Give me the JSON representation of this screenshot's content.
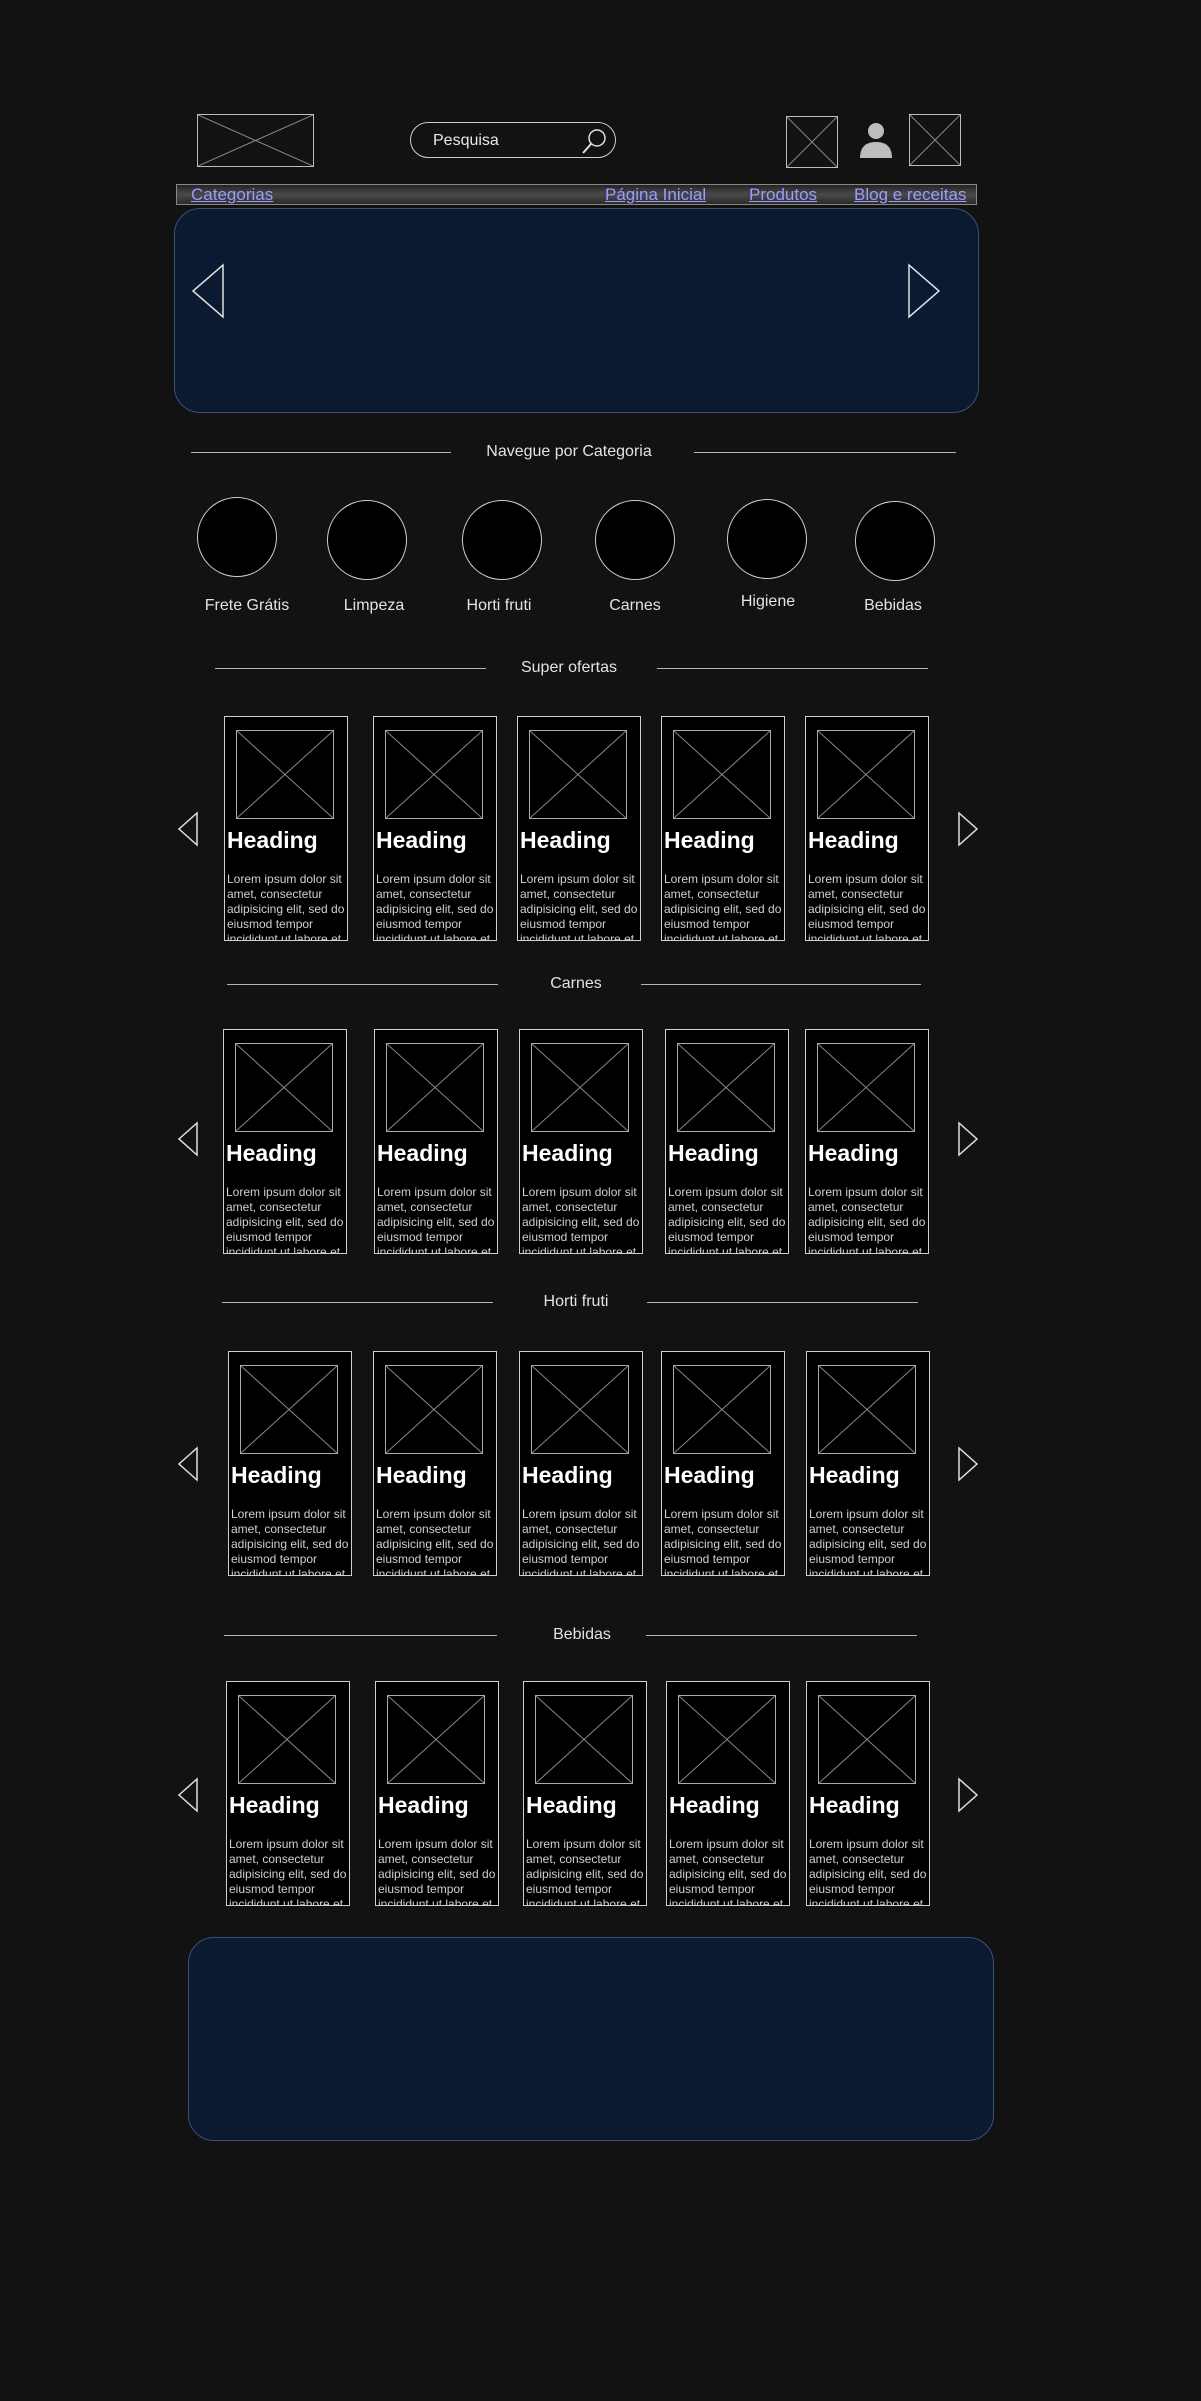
{
  "header": {
    "search_placeholder": "Pesquisa"
  },
  "nav": {
    "categories": "Categorias",
    "home": "Página Inicial",
    "products": "Produtos",
    "blog": "Blog e receitas"
  },
  "categories_section": {
    "title": "Navegue por Categoria",
    "items": [
      {
        "label": "Frete Grátis"
      },
      {
        "label": "Limpeza"
      },
      {
        "label": "Horti fruti"
      },
      {
        "label": "Carnes"
      },
      {
        "label": "Higiene"
      },
      {
        "label": "Bebidas"
      }
    ]
  },
  "sections": [
    {
      "title": "Super ofertas",
      "cards": [
        {
          "heading": "Heading",
          "text": "Lorem ipsum dolor sit amet, consectetur adipisicing elit, sed do eiusmod tempor incididunt ut labore et"
        },
        {
          "heading": "Heading",
          "text": "Lorem ipsum dolor sit amet, consectetur adipisicing elit, sed do eiusmod tempor incididunt ut labore et"
        },
        {
          "heading": "Heading",
          "text": "Lorem ipsum dolor sit amet, consectetur adipisicing elit, sed do eiusmod tempor incididunt ut labore et"
        },
        {
          "heading": "Heading",
          "text": "Lorem ipsum dolor sit amet, consectetur adipisicing elit, sed do eiusmod tempor incididunt ut labore et"
        },
        {
          "heading": "Heading",
          "text": "Lorem ipsum dolor sit amet, consectetur adipisicing elit, sed do eiusmod tempor incididunt ut labore et"
        }
      ]
    },
    {
      "title": "Carnes",
      "cards": [
        {
          "heading": "Heading",
          "text": "Lorem ipsum dolor sit amet, consectetur adipisicing elit, sed do eiusmod tempor incididunt ut labore et"
        },
        {
          "heading": "Heading",
          "text": "Lorem ipsum dolor sit amet, consectetur adipisicing elit, sed do eiusmod tempor incididunt ut labore et"
        },
        {
          "heading": "Heading",
          "text": "Lorem ipsum dolor sit amet, consectetur adipisicing elit, sed do eiusmod tempor incididunt ut labore et"
        },
        {
          "heading": "Heading",
          "text": "Lorem ipsum dolor sit amet, consectetur adipisicing elit, sed do eiusmod tempor incididunt ut labore et"
        },
        {
          "heading": "Heading",
          "text": "Lorem ipsum dolor sit amet, consectetur adipisicing elit, sed do eiusmod tempor incididunt ut labore et"
        }
      ]
    },
    {
      "title": "Horti fruti",
      "cards": [
        {
          "heading": "Heading",
          "text": "Lorem ipsum dolor sit amet, consectetur adipisicing elit, sed do eiusmod tempor incididunt ut labore et"
        },
        {
          "heading": "Heading",
          "text": "Lorem ipsum dolor sit amet, consectetur adipisicing elit, sed do eiusmod tempor incididunt ut labore et"
        },
        {
          "heading": "Heading",
          "text": "Lorem ipsum dolor sit amet, consectetur adipisicing elit, sed do eiusmod tempor incididunt ut labore et"
        },
        {
          "heading": "Heading",
          "text": "Lorem ipsum dolor sit amet, consectetur adipisicing elit, sed do eiusmod tempor incididunt ut labore et"
        },
        {
          "heading": "Heading",
          "text": "Lorem ipsum dolor sit amet, consectetur adipisicing elit, sed do eiusmod tempor incididunt ut labore et"
        }
      ]
    },
    {
      "title": "Bebidas",
      "cards": [
        {
          "heading": "Heading",
          "text": "Lorem ipsum dolor sit amet, consectetur adipisicing elit, sed do eiusmod tempor incididunt ut labore et"
        },
        {
          "heading": "Heading",
          "text": "Lorem ipsum dolor sit amet, consectetur adipisicing elit, sed do eiusmod tempor incididunt ut labore et"
        },
        {
          "heading": "Heading",
          "text": "Lorem ipsum dolor sit amet, consectetur adipisicing elit, sed do eiusmod tempor incididunt ut labore et"
        },
        {
          "heading": "Heading",
          "text": "Lorem ipsum dolor sit amet, consectetur adipisicing elit, sed do eiusmod tempor incididunt ut labore et"
        },
        {
          "heading": "Heading",
          "text": "Lorem ipsum dolor sit amet, consectetur adipisicing elit, sed do eiusmod tempor incididunt ut labore et"
        }
      ]
    }
  ],
  "theme": {
    "background": "#121212",
    "banner_fill": "#0b1a30",
    "link_color": "#9a9cff"
  }
}
